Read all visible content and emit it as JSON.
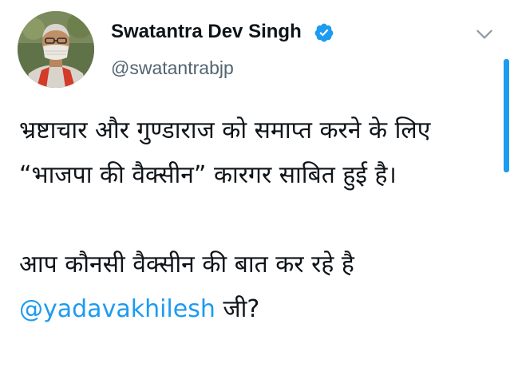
{
  "author": {
    "display_name": "Swatantra Dev Singh",
    "handle": "@swatantrabjp",
    "verified_icon": "verified-badge-icon",
    "menu_icon": "chevron-down-icon"
  },
  "tweet": {
    "paragraph_1": "भ्रष्टाचार और गुण्डाराज को समाप्त करने के लिए “भाजपा की वैक्सीन” कारगर साबित हुई है।",
    "paragraph_2_prefix": "आप कौनसी वैक्सीन की बात कर रहे है",
    "mention": "@yadavakhilesh",
    "paragraph_2_suffix": " जी?"
  },
  "colors": {
    "link": "#1d9bf0",
    "verified": "#1d9bf0",
    "text": "#0f1419",
    "secondary": "#536471"
  }
}
